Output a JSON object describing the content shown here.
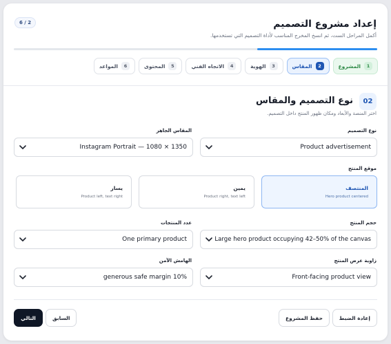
{
  "header": {
    "title": "إعداد مشروع التصميم",
    "subtitle": "أكمل المراحل الست، ثم انسخ المخرج المناسب لأداة التصميم التي تستخدمها.",
    "step_count": "6 / 2",
    "progress_percent": 33
  },
  "tabs": [
    {
      "num": "1",
      "label": "المشروع",
      "state": "done"
    },
    {
      "num": "2",
      "label": "المقاس",
      "state": "active"
    },
    {
      "num": "3",
      "label": "الهوية",
      "state": "normal"
    },
    {
      "num": "4",
      "label": "الاتجاه الفني",
      "state": "normal"
    },
    {
      "num": "5",
      "label": "المحتوى",
      "state": "normal"
    },
    {
      "num": "6",
      "label": "المواعد",
      "state": "normal"
    }
  ],
  "section": {
    "number": "02",
    "title": "نوع التصميم والمقاس",
    "subtitle": "اختر المنصة والأبعاد ومكان ظهور المنتج داخل التصميم."
  },
  "fields": {
    "design_type": {
      "label": "نوع التصميم",
      "value": "Product advertisement"
    },
    "ready_size": {
      "label": "المقاس الجاهز",
      "value": "Instagram Portrait — 1080 × 1350"
    },
    "product_position": {
      "label": "موقع المنتج",
      "options": [
        {
          "title": "المنتصف",
          "desc": "Hero product centered",
          "selected": true
        },
        {
          "title": "يمين",
          "desc": "Product right, text left",
          "selected": false
        },
        {
          "title": "يسار",
          "desc": "Product left, text right",
          "selected": false
        }
      ]
    },
    "product_size": {
      "label": "حجم المنتج",
      "value": "Large hero product occupying 42–50% of the canvas"
    },
    "product_count": {
      "label": "عدد المنتجات",
      "value": "One primary product"
    },
    "view_angle": {
      "label": "زاوية عرض المنتج",
      "value": "Front-facing product view"
    },
    "safe_margin": {
      "label": "الهامش الآمن",
      "value": "generous safe margin 10%"
    }
  },
  "footer": {
    "reset": "إعادة الضبط",
    "save": "حفظ المشروع",
    "prev": "السابق",
    "next": "التالي"
  }
}
